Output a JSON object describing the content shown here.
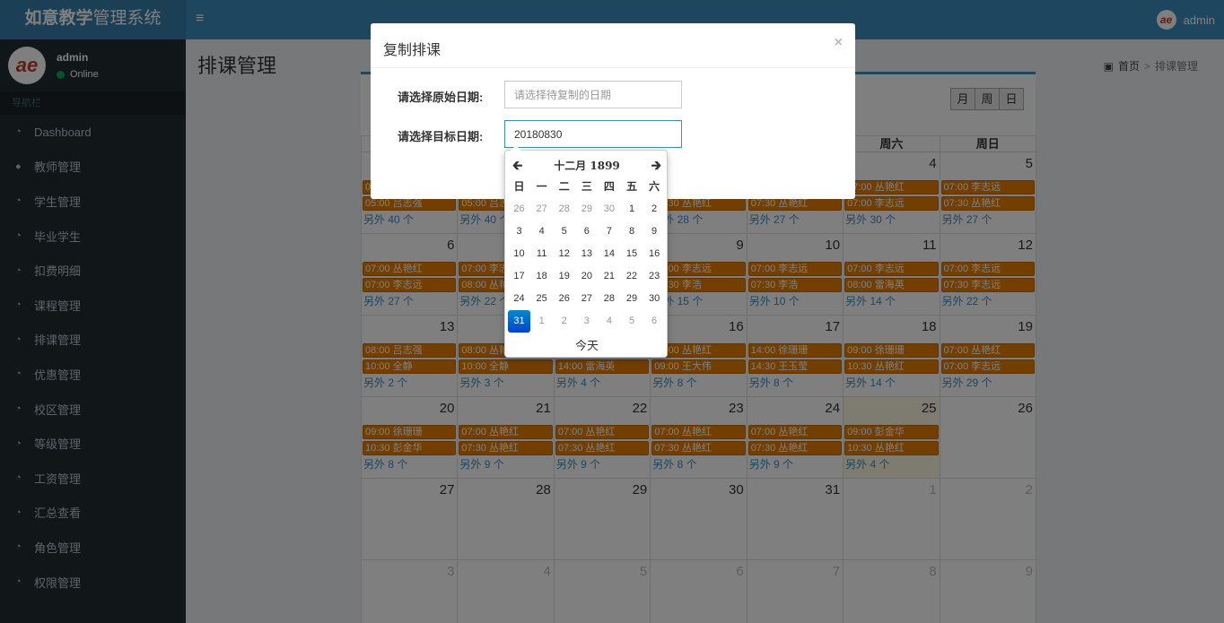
{
  "header": {
    "logo_bold": "如意教学",
    "logo_rest": "管理系统",
    "menu_icon": "≡",
    "username": "admin",
    "avatar_text": "ae"
  },
  "sidebar": {
    "user": {
      "name": "admin",
      "status": "Online",
      "avatar_text": "ae"
    },
    "nav_header": "导航栏",
    "items": [
      {
        "icon": "dashboard-icon",
        "label": "Dashboard"
      },
      {
        "icon": "user-icon",
        "label": "教师管理"
      },
      {
        "icon": "dashboard-icon",
        "label": "学生管理"
      },
      {
        "icon": "dashboard-icon",
        "label": "毕业学生"
      },
      {
        "icon": "dashboard-icon",
        "label": "扣费明细"
      },
      {
        "icon": "dashboard-icon",
        "label": "课程管理"
      },
      {
        "icon": "dashboard-icon",
        "label": "排课管理"
      },
      {
        "icon": "dashboard-icon",
        "label": "优惠管理"
      },
      {
        "icon": "dashboard-icon",
        "label": "校区管理"
      },
      {
        "icon": "dashboard-icon",
        "label": "等级管理"
      },
      {
        "icon": "dashboard-icon",
        "label": "工资管理"
      },
      {
        "icon": "dashboard-icon",
        "label": "汇总查看"
      },
      {
        "icon": "dashboard-icon",
        "label": "角色管理"
      },
      {
        "icon": "dashboard-icon",
        "label": "权限管理"
      }
    ]
  },
  "page": {
    "title": "排课管理",
    "breadcrumb_home": "首页",
    "breadcrumb_current": "排课管理"
  },
  "calendar": {
    "view_buttons": [
      "月",
      "周",
      "日"
    ],
    "headers": [
      "周一",
      "周二",
      "周三",
      "周四",
      "周五",
      "周六",
      "周日"
    ],
    "weeks": [
      [
        {
          "num": "",
          "ev": [
            "07:00 李志远",
            "05:00 吕志强"
          ],
          "more": "另外 40 个"
        },
        {
          "num": "",
          "ev": [
            "07:00 李志远",
            "05:00 吕志强"
          ],
          "more": "另外 40 个"
        },
        {
          "num": "",
          "ev": [
            "",
            ""
          ],
          "more": ""
        },
        {
          "num": "",
          "ev": [
            "07:00 丛艳红",
            "07:30 丛艳红"
          ],
          "more": "另外 28 个"
        },
        {
          "num": "",
          "ev": [
            "07:00 丛艳红",
            "07:30 丛艳红"
          ],
          "more": "另外 27 个"
        },
        {
          "num": "4",
          "ev": [
            "07:00 丛艳红",
            "07:00 李志远"
          ],
          "more": "另外 30 个"
        },
        {
          "num": "5",
          "ev": [
            "07:00 李志远",
            "07:30 丛艳红"
          ],
          "more": "另外 27 个"
        }
      ],
      [
        {
          "num": "6",
          "ev": [
            "07:00 丛艳红",
            "07:00 李志远"
          ],
          "more": "另外 27 个"
        },
        {
          "num": "7",
          "ev": [
            "07:00 李志远",
            "08:00 丛艳红"
          ],
          "more": "另外 22 个"
        },
        {
          "num": "8",
          "ev": [
            "",
            ""
          ],
          "more": ""
        },
        {
          "num": "9",
          "ev": [
            "07:00 李志远",
            "07:30 李浩"
          ],
          "more": "另外 15 个"
        },
        {
          "num": "10",
          "ev": [
            "07:00 李志远",
            "07:30 李浩"
          ],
          "more": "另外 10 个"
        },
        {
          "num": "11",
          "ev": [
            "07:00 李志远",
            "08:00 雷海英"
          ],
          "more": "另外 14 个"
        },
        {
          "num": "12",
          "ev": [
            "07:00 李志远",
            "07:30 李志远"
          ],
          "more": "另外 22 个"
        }
      ],
      [
        {
          "num": "13",
          "ev": [
            "08:00 吕志强",
            "10:00 全静"
          ],
          "more": "另外 2 个"
        },
        {
          "num": "14",
          "ev": [
            "08:00 丛艳红",
            "10:00 全静"
          ],
          "more": "另外 3 个"
        },
        {
          "num": "15",
          "ev": [
            "",
            "14:00 雷海英"
          ],
          "more": "另外 4 个"
        },
        {
          "num": "16",
          "ev": [
            "07:00 丛艳红",
            "09:00 王大伟"
          ],
          "more": "另外 8 个"
        },
        {
          "num": "17",
          "ev": [
            "14:00 徐珊珊",
            "14:30 王玉莹"
          ],
          "more": "另外 8 个"
        },
        {
          "num": "18",
          "ev": [
            "09:00 徐珊珊",
            "10:30 丛艳红"
          ],
          "more": "另外 14 个"
        },
        {
          "num": "19",
          "ev": [
            "07:00 丛艳红",
            "07:00 李志远"
          ],
          "more": "另外 29 个"
        }
      ],
      [
        {
          "num": "20",
          "ev": [
            "09:00 徐珊珊",
            "10:30 彭金华"
          ],
          "more": "另外 8 个"
        },
        {
          "num": "21",
          "ev": [
            "07:00 丛艳红",
            "07:30 丛艳红"
          ],
          "more": "另外 9 个"
        },
        {
          "num": "22",
          "ev": [
            "07:00 丛艳红",
            "07:30 丛艳红"
          ],
          "more": "另外 9 个"
        },
        {
          "num": "23",
          "ev": [
            "07:00 丛艳红",
            "07:30 丛艳红"
          ],
          "more": "另外 8 个"
        },
        {
          "num": "24",
          "ev": [
            "07:00 丛艳红",
            "07:30 丛艳红"
          ],
          "more": "另外 9 个"
        },
        {
          "num": "25",
          "ev": [
            "09:00 彭金华",
            "10:30 丛艳红"
          ],
          "more": "另外 4 个",
          "today": true
        },
        {
          "num": "26",
          "ev": [
            "",
            ""
          ],
          "more": ""
        }
      ],
      [
        {
          "num": "27",
          "ev": [
            "",
            ""
          ],
          "more": ""
        },
        {
          "num": "28",
          "ev": [
            "",
            ""
          ],
          "more": ""
        },
        {
          "num": "29",
          "ev": [
            "",
            ""
          ],
          "more": ""
        },
        {
          "num": "30",
          "ev": [
            "",
            ""
          ],
          "more": ""
        },
        {
          "num": "31",
          "ev": [
            "",
            ""
          ],
          "more": ""
        },
        {
          "num": "1",
          "ev": [
            "",
            ""
          ],
          "more": "",
          "other": true
        },
        {
          "num": "2",
          "ev": [
            "",
            ""
          ],
          "more": "",
          "other": true
        }
      ],
      [
        {
          "num": "3",
          "ev": [
            "",
            ""
          ],
          "more": "",
          "other": true
        },
        {
          "num": "4",
          "ev": [
            "",
            ""
          ],
          "more": "",
          "other": true
        },
        {
          "num": "5",
          "ev": [
            "",
            ""
          ],
          "more": "",
          "other": true
        },
        {
          "num": "6",
          "ev": [
            "",
            ""
          ],
          "more": "",
          "other": true
        },
        {
          "num": "7",
          "ev": [
            "",
            ""
          ],
          "more": "",
          "other": true
        },
        {
          "num": "8",
          "ev": [
            "",
            ""
          ],
          "more": "",
          "other": true
        },
        {
          "num": "9",
          "ev": [
            "",
            ""
          ],
          "more": "",
          "other": true
        }
      ]
    ]
  },
  "modal": {
    "title": "复制排课",
    "close": "×",
    "source_label": "请选择原始日期:",
    "source_placeholder": "请选择待复制的日期",
    "target_label": "请选择目标日期:",
    "target_value": "20180830"
  },
  "datepicker": {
    "title": "十二月 1899",
    "prev": "🡰",
    "next": "🡲",
    "weekdays": [
      "日",
      "一",
      "二",
      "三",
      "四",
      "五",
      "六"
    ],
    "rows": [
      [
        {
          "d": "26",
          "old": true
        },
        {
          "d": "27",
          "old": true
        },
        {
          "d": "28",
          "old": true
        },
        {
          "d": "29",
          "old": true
        },
        {
          "d": "30",
          "old": true
        },
        {
          "d": "1"
        },
        {
          "d": "2"
        }
      ],
      [
        {
          "d": "3"
        },
        {
          "d": "4"
        },
        {
          "d": "5"
        },
        {
          "d": "6"
        },
        {
          "d": "7"
        },
        {
          "d": "8"
        },
        {
          "d": "9"
        }
      ],
      [
        {
          "d": "10"
        },
        {
          "d": "11"
        },
        {
          "d": "12"
        },
        {
          "d": "13"
        },
        {
          "d": "14"
        },
        {
          "d": "15"
        },
        {
          "d": "16"
        }
      ],
      [
        {
          "d": "17"
        },
        {
          "d": "18"
        },
        {
          "d": "19"
        },
        {
          "d": "20"
        },
        {
          "d": "21"
        },
        {
          "d": "22"
        },
        {
          "d": "23"
        }
      ],
      [
        {
          "d": "24"
        },
        {
          "d": "25"
        },
        {
          "d": "26"
        },
        {
          "d": "27"
        },
        {
          "d": "28"
        },
        {
          "d": "29"
        },
        {
          "d": "30"
        }
      ],
      [
        {
          "d": "31",
          "sel": true
        },
        {
          "d": "1",
          "old": true
        },
        {
          "d": "2",
          "old": true
        },
        {
          "d": "3",
          "old": true
        },
        {
          "d": "4",
          "old": true
        },
        {
          "d": "5",
          "old": true
        },
        {
          "d": "6",
          "old": true
        }
      ]
    ],
    "today_label": "今天"
  }
}
